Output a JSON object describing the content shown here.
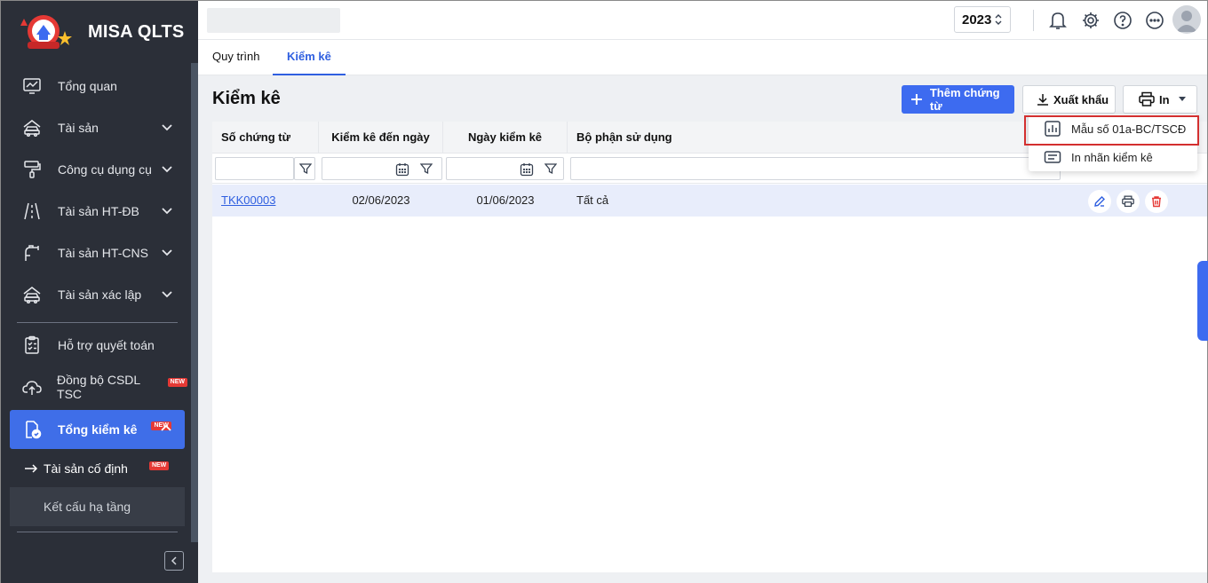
{
  "app": {
    "brand_name": "MISA QLTS",
    "year": "2023"
  },
  "sidebar": {
    "items": [
      {
        "label": "Tổng quan",
        "icon": "monitor-chart-icon"
      },
      {
        "label": "Tài sản",
        "icon": "car-house-icon"
      },
      {
        "label": "Công cụ dụng cụ",
        "icon": "paint-roller-icon"
      },
      {
        "label": "Tài sản HT-ĐB",
        "icon": "road-icon"
      },
      {
        "label": "Tài sản HT-CNS",
        "icon": "faucet-icon"
      },
      {
        "label": "Tài sản xác lập",
        "icon": "car-house-icon"
      },
      {
        "label": "Hỗ trợ quyết toán",
        "icon": "clipboard-check-icon"
      },
      {
        "label": "Đồng bộ CSDL TSC",
        "icon": "cloud-upload-icon",
        "badge": "NEW"
      },
      {
        "label": "Tổng kiểm kê",
        "icon": "document-check-icon",
        "badge": "NEW"
      }
    ],
    "sub_items": [
      {
        "label": "Tài sản cố định",
        "badge": "NEW"
      },
      {
        "label": "Kết cấu hạ tầng"
      }
    ]
  },
  "tabs": [
    {
      "label": "Quy trình"
    },
    {
      "label": "Kiểm kê"
    }
  ],
  "main": {
    "title": "Kiểm kê",
    "add_button": "Thêm chứng từ",
    "export_button": "Xuất khẩu",
    "print_button": "In"
  },
  "table": {
    "columns": [
      "Số chứng từ",
      "Kiểm kê đến ngày",
      "Ngày kiểm kê",
      "Bộ phận sử dụng"
    ],
    "rows": [
      {
        "so_chung_tu": "TKK00003",
        "kiem_ke_den_ngay": "02/06/2023",
        "ngay_kiem_ke": "01/06/2023",
        "bo_phan": "Tất cả"
      }
    ]
  },
  "print_menu": {
    "items": [
      {
        "label": "Mẫu số 01a-BC/TSCĐ",
        "icon": "bar-chart-icon"
      },
      {
        "label": "In nhãn kiểm kê",
        "icon": "label-icon"
      }
    ]
  },
  "colors": {
    "primary": "#3d6bf0",
    "sidebar_bg": "#2b2f38",
    "highlight_border": "#d32f2f"
  }
}
